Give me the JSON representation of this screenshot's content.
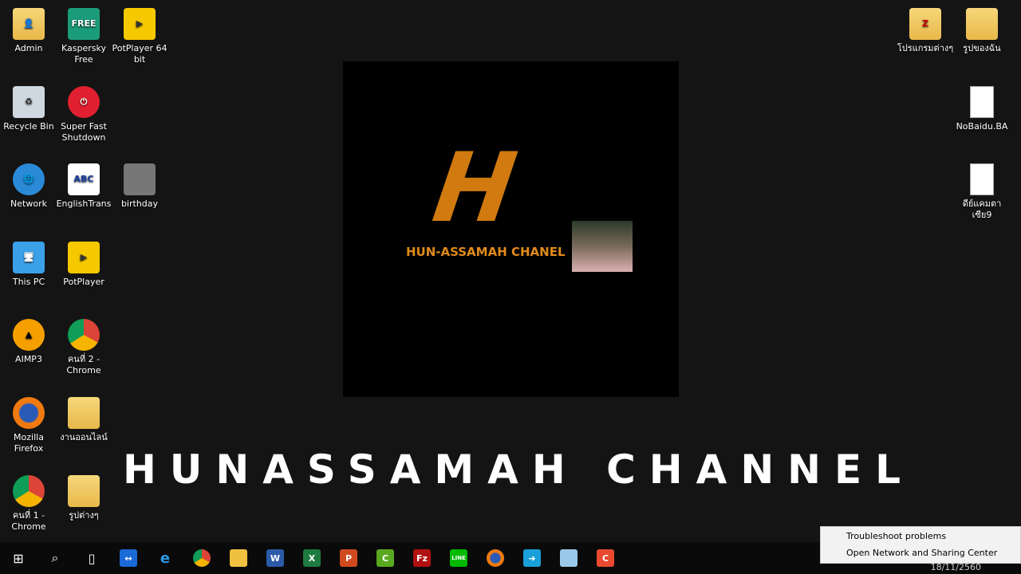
{
  "desktop_icons_left": [
    {
      "label": "Admin",
      "icon": "user-folder-icon"
    },
    {
      "label": "Kaspersky Free",
      "icon": "kaspersky-icon"
    },
    {
      "label": "PotPlayer 64 bit",
      "icon": "potplayer-icon"
    },
    {
      "label": "Recycle Bin",
      "icon": "recycle-bin-icon"
    },
    {
      "label": "Super Fast Shutdown",
      "icon": "shutdown-icon"
    },
    {
      "label": "Network",
      "icon": "network-icon"
    },
    {
      "label": "EnglishTrans",
      "icon": "abc-icon"
    },
    {
      "label": "birthday",
      "icon": "image-icon"
    },
    {
      "label": "This PC",
      "icon": "computer-icon"
    },
    {
      "label": "PotPlayer",
      "icon": "potplayer-icon"
    },
    {
      "label": "AIMP3",
      "icon": "aimp-icon"
    },
    {
      "label": "คนที่ 2 - Chrome",
      "icon": "chrome-icon"
    },
    {
      "label": "Mozilla Firefox",
      "icon": "firefox-icon"
    },
    {
      "label": "งานออนไลน์",
      "icon": "folder-icon"
    },
    {
      "label": "คนที่ 1 - Chrome",
      "icon": "chrome-icon"
    },
    {
      "label": "รูปต่างๆ",
      "icon": "folder-icon"
    }
  ],
  "desktop_icons_right": [
    {
      "label": "โปรแกรมต่างๆ",
      "icon": "folder-icon"
    },
    {
      "label": "รูปของฉัน",
      "icon": "folder-icon"
    },
    {
      "label": "NoBaidu.BA",
      "icon": "document-icon"
    },
    {
      "label": "ดีย์แคมตาเซีย9",
      "icon": "document-icon"
    }
  ],
  "logo": {
    "letter": "H",
    "channel": "HUN-ASSAMAH CHANEL"
  },
  "banner": "HUNASSAMAH CHANNEL",
  "context_menu": [
    "Troubleshoot problems",
    "Open Network and Sharing Center"
  ],
  "clock": {
    "date": "18/11/2560"
  },
  "taskbar": [
    "start",
    "search",
    "task-view",
    "teamviewer",
    "internet-explorer",
    "chrome",
    "file-explorer",
    "word",
    "excel",
    "powerpoint",
    "camtasia",
    "filezilla",
    "line",
    "firefox",
    "remote",
    "notepad",
    "camtasia-recorder"
  ]
}
